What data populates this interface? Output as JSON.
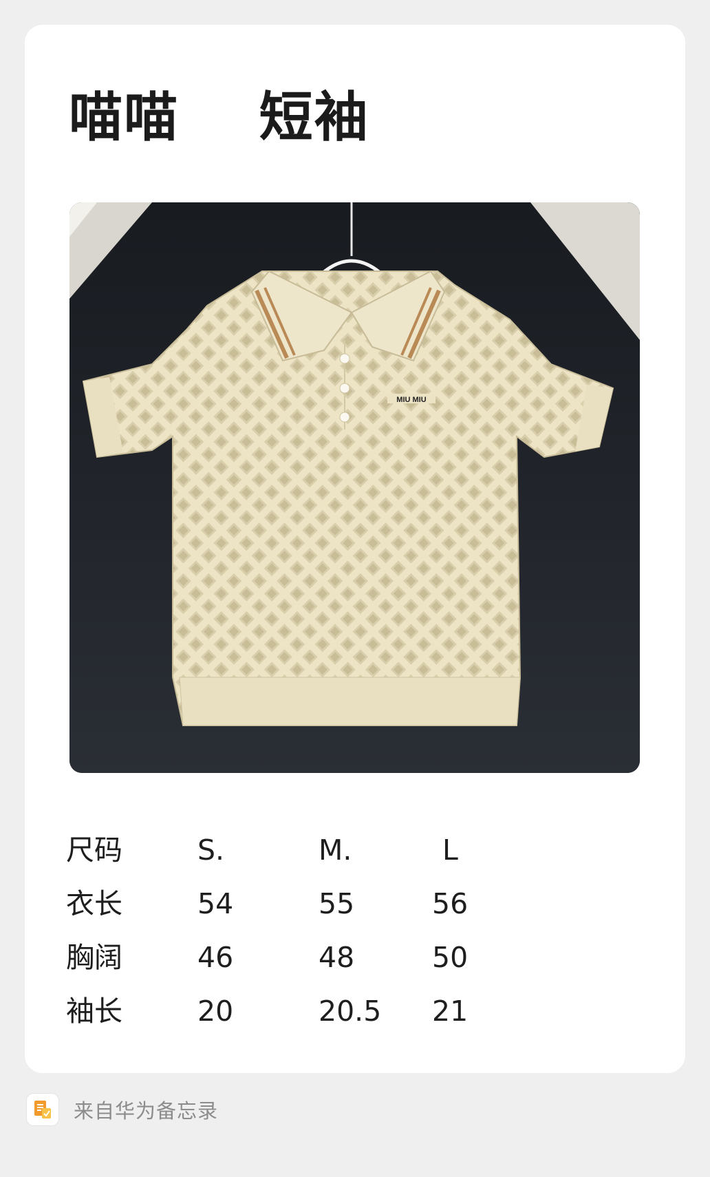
{
  "note": {
    "title": "喵喵    短袖"
  },
  "product_image": {
    "icon": "shirt-photo",
    "logo_text": "MIU MIU"
  },
  "size_table": {
    "header": [
      "尺码",
      "S.",
      "M.",
      "L"
    ],
    "rows": [
      [
        "衣长",
        "54",
        "55",
        "56"
      ],
      [
        "胸阔",
        "46",
        "48",
        "50"
      ],
      [
        "袖长",
        "20",
        "20.5",
        "21"
      ]
    ]
  },
  "footer": {
    "icon": "memo-app-icon",
    "text": "来自华为备忘录"
  },
  "colors": {
    "background": "#efefef",
    "card": "#ffffff",
    "shirt": "#ede4c6",
    "collar_stripe": "#b98a55",
    "photo_background": "#22262b",
    "memo_icon_orange": "#f39a2c"
  }
}
